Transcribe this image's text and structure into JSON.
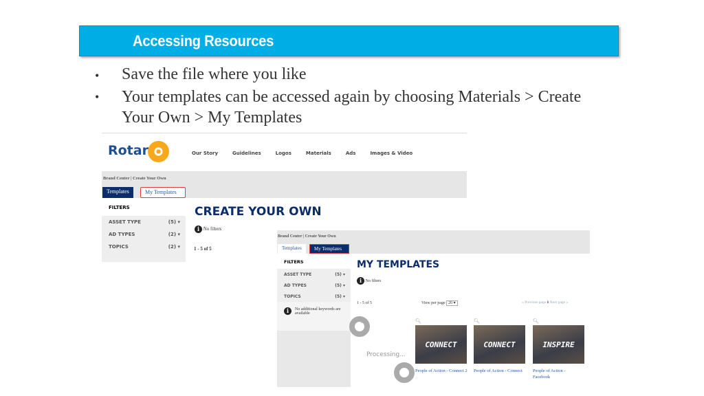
{
  "slide": {
    "title": "Accessing Resources",
    "bullets": [
      "Save the file where you like",
      "Your templates can be accessed again by choosing Materials > Create Your Own > My Templates"
    ],
    "accent": "#00aee6"
  },
  "shot1": {
    "logo": "Rotary",
    "nav": [
      "Our Story",
      "Guidelines",
      "Logos",
      "Materials",
      "Ads",
      "Images & Video"
    ],
    "breadcrumb": "Brand Center | Create Your Own",
    "tabs": [
      "Templates",
      "My Templates"
    ],
    "filters_title": "FILTERS",
    "filters": [
      {
        "label": "ASSET TYPE",
        "count": "(5)"
      },
      {
        "label": "AD TYPES",
        "count": "(2)"
      },
      {
        "label": "TOPICS",
        "count": "(2)"
      }
    ],
    "heading": "CREATE YOUR OWN",
    "no_filters": "No filters",
    "results": "1 - 5 of 5"
  },
  "shot2": {
    "breadcrumb": "Brand Center | Create Your Own",
    "tabs": [
      "Templates",
      "My Templates"
    ],
    "filters_title": "FILTERS",
    "filters": [
      {
        "label": "ASSET TYPE",
        "count": "(5)"
      },
      {
        "label": "AD TYPES",
        "count": "(5)"
      },
      {
        "label": "TOPICS",
        "count": "(5)"
      }
    ],
    "no_keywords": "No additional keywords are available",
    "heading": "MY TEMPLATES",
    "no_filters": "No filters",
    "results": "1 - 5 of 5",
    "view_per_page": "View per page",
    "per_page_value": "20",
    "prev": "« Previous page",
    "page": "1",
    "next": "Next page »",
    "processing": "Processing...",
    "cards": [
      {
        "caption_text": "CONNECT",
        "title": "People of Action - Connect 2"
      },
      {
        "caption_text": "CONNECT",
        "title": "People of Action - Connect"
      },
      {
        "caption_text": "INSPIRE",
        "title": "People of Action - Facebook"
      }
    ]
  }
}
